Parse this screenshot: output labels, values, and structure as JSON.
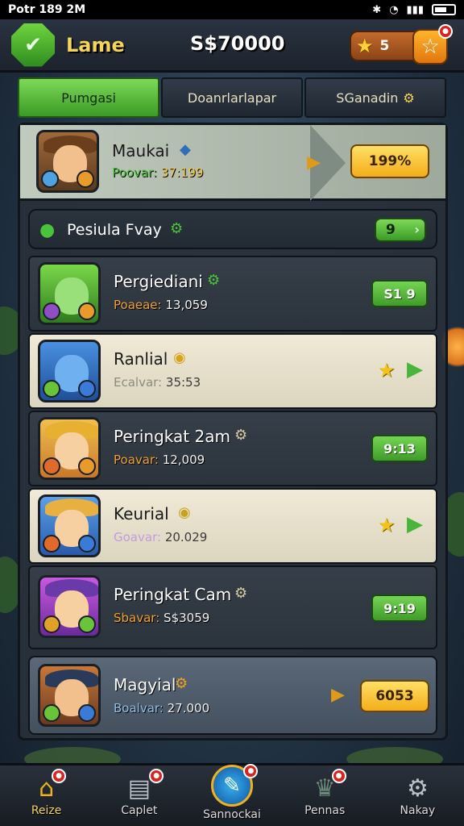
{
  "status_bar": {
    "time": "Potr 189 2M"
  },
  "header": {
    "title": "Lame",
    "coins": "S$70000",
    "stars": "5"
  },
  "tabs": [
    {
      "label": "Pumgasi",
      "active": true
    },
    {
      "label": "Doanrlarlapar",
      "active": false
    },
    {
      "label": "SGanadin",
      "active": false
    }
  ],
  "featured": {
    "name": "Maukai",
    "stat_label": "Poovar:",
    "stat_value": "37:199",
    "button": "199%"
  },
  "section": {
    "title": "Pesiula Fvay",
    "count": "9"
  },
  "rows": [
    {
      "name": "Pergiediani",
      "stat_label": "Poaeae:",
      "stat_value": "13,059",
      "score": "S1 9"
    },
    {
      "name": "Ranlial",
      "stat_label": "Ecalvar:",
      "stat_value": "35:53"
    },
    {
      "name": "Peringkat 2am",
      "stat_label": "Poavar:",
      "stat_value": "12,009",
      "score": "9:13"
    },
    {
      "name": "Keurial",
      "stat_label": "Goavar:",
      "stat_value": "20.029"
    },
    {
      "name": "Peringkat Cam",
      "stat_label": "Sbavar:",
      "stat_value": "S$3059",
      "score": "9:19"
    }
  ],
  "bottom_card": {
    "name": "Magyial",
    "stat_label": "Boalvar:",
    "stat_value": "27.000",
    "button": "6053"
  },
  "nav": [
    {
      "label": "Reize",
      "badge": ""
    },
    {
      "label": "Caplet",
      "badge": ""
    },
    {
      "label": "Sannockai",
      "badge": ""
    },
    {
      "label": "Pennas",
      "badge": ""
    },
    {
      "label": "Nakay",
      "badge": ""
    }
  ],
  "colors": {
    "accent_green": "#49c43a",
    "accent_gold": "#f3ad18",
    "badge_red": "#d8241f"
  }
}
